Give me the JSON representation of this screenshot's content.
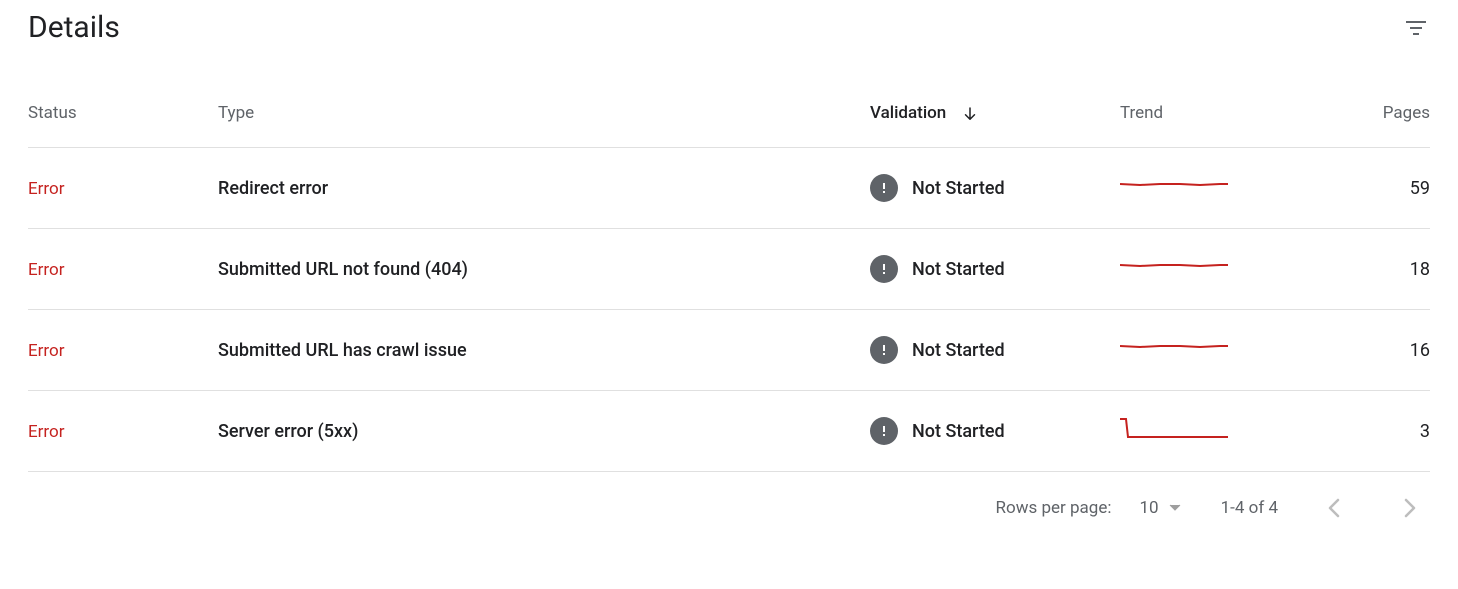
{
  "header": {
    "title": "Details"
  },
  "columns": {
    "status": "Status",
    "type": "Type",
    "validation": "Validation",
    "trend": "Trend",
    "pages": "Pages",
    "sorted": "validation",
    "sort_dir": "desc"
  },
  "rows": [
    {
      "status": "Error",
      "type": "Redirect error",
      "validation": "Not Started",
      "trend_shape": "flat",
      "pages": 59
    },
    {
      "status": "Error",
      "type": "Submitted URL not found (404)",
      "validation": "Not Started",
      "trend_shape": "flat",
      "pages": 18
    },
    {
      "status": "Error",
      "type": "Submitted URL has crawl issue",
      "validation": "Not Started",
      "trend_shape": "flat",
      "pages": 16
    },
    {
      "status": "Error",
      "type": "Server error (5xx)",
      "validation": "Not Started",
      "trend_shape": "drop",
      "pages": 3
    }
  ],
  "pagination": {
    "rows_per_page_label": "Rows per page:",
    "rows_per_page_value": "10",
    "range_text": "1-4 of 4",
    "prev_enabled": false,
    "next_enabled": false
  },
  "colors": {
    "error": "#c5221f",
    "muted": "#5f6368",
    "text": "#202124"
  }
}
